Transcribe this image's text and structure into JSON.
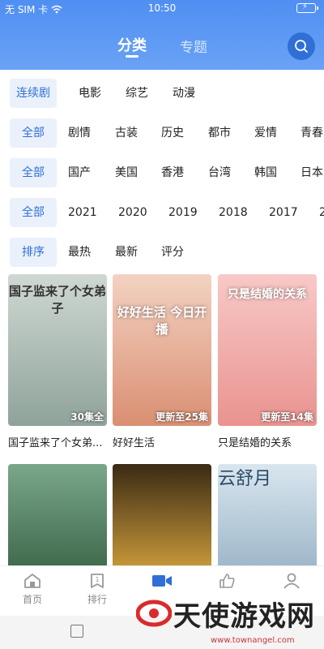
{
  "status": {
    "carrier": "无 SIM 卡",
    "time": "10:50"
  },
  "header": {
    "tabs": [
      "分类",
      "专题"
    ],
    "active_tab": 0
  },
  "filters": [
    [
      "连续剧",
      "电影",
      "综艺",
      "动漫"
    ],
    [
      "全部",
      "剧情",
      "古装",
      "历史",
      "都市",
      "爱情",
      "青春"
    ],
    [
      "全部",
      "国产",
      "美国",
      "香港",
      "台湾",
      "韩国",
      "日本"
    ],
    [
      "全部",
      "2021",
      "2020",
      "2019",
      "2018",
      "2017",
      "2"
    ],
    [
      "排序",
      "最热",
      "最新",
      "评分"
    ]
  ],
  "cards": [
    {
      "title": "国子监来了个女弟...",
      "poster_text": "国子监来了个女弟子",
      "badge": "30集全",
      "color_top": "#cfd8d2",
      "color_bottom": "#8fa39a"
    },
    {
      "title": "好好生活",
      "poster_text": "好好生活 今日开播",
      "badge": "更新至25集",
      "color_top": "#f3d2c2",
      "color_bottom": "#d98f72"
    },
    {
      "title": "只是结婚的关系",
      "poster_text": "只是结婚的关系",
      "badge": "更新至14集",
      "color_top": "#f8c9c7",
      "color_bottom": "#e9938f"
    }
  ],
  "cards_row2": [
    {
      "color_top": "#7aa68a",
      "color_bottom": "#3f6a4c"
    },
    {
      "color_top": "#3a2a14",
      "color_bottom": "#c99a3a"
    },
    {
      "poster_text": "云舒月",
      "color_top": "#d9e6ef",
      "color_bottom": "#9db6c9"
    }
  ],
  "nav": [
    {
      "label": "首页",
      "icon": "home-icon"
    },
    {
      "label": "排行",
      "icon": "ranking-icon"
    },
    {
      "label": "",
      "icon": "video-icon"
    },
    {
      "label": "",
      "icon": "thumb-icon"
    },
    {
      "label": "",
      "icon": "user-icon"
    }
  ],
  "watermark": {
    "text": "天使游戏网",
    "url": "www.townangel.com"
  },
  "colors": {
    "accent": "#2f6fd6",
    "header": "#5b96f3"
  }
}
